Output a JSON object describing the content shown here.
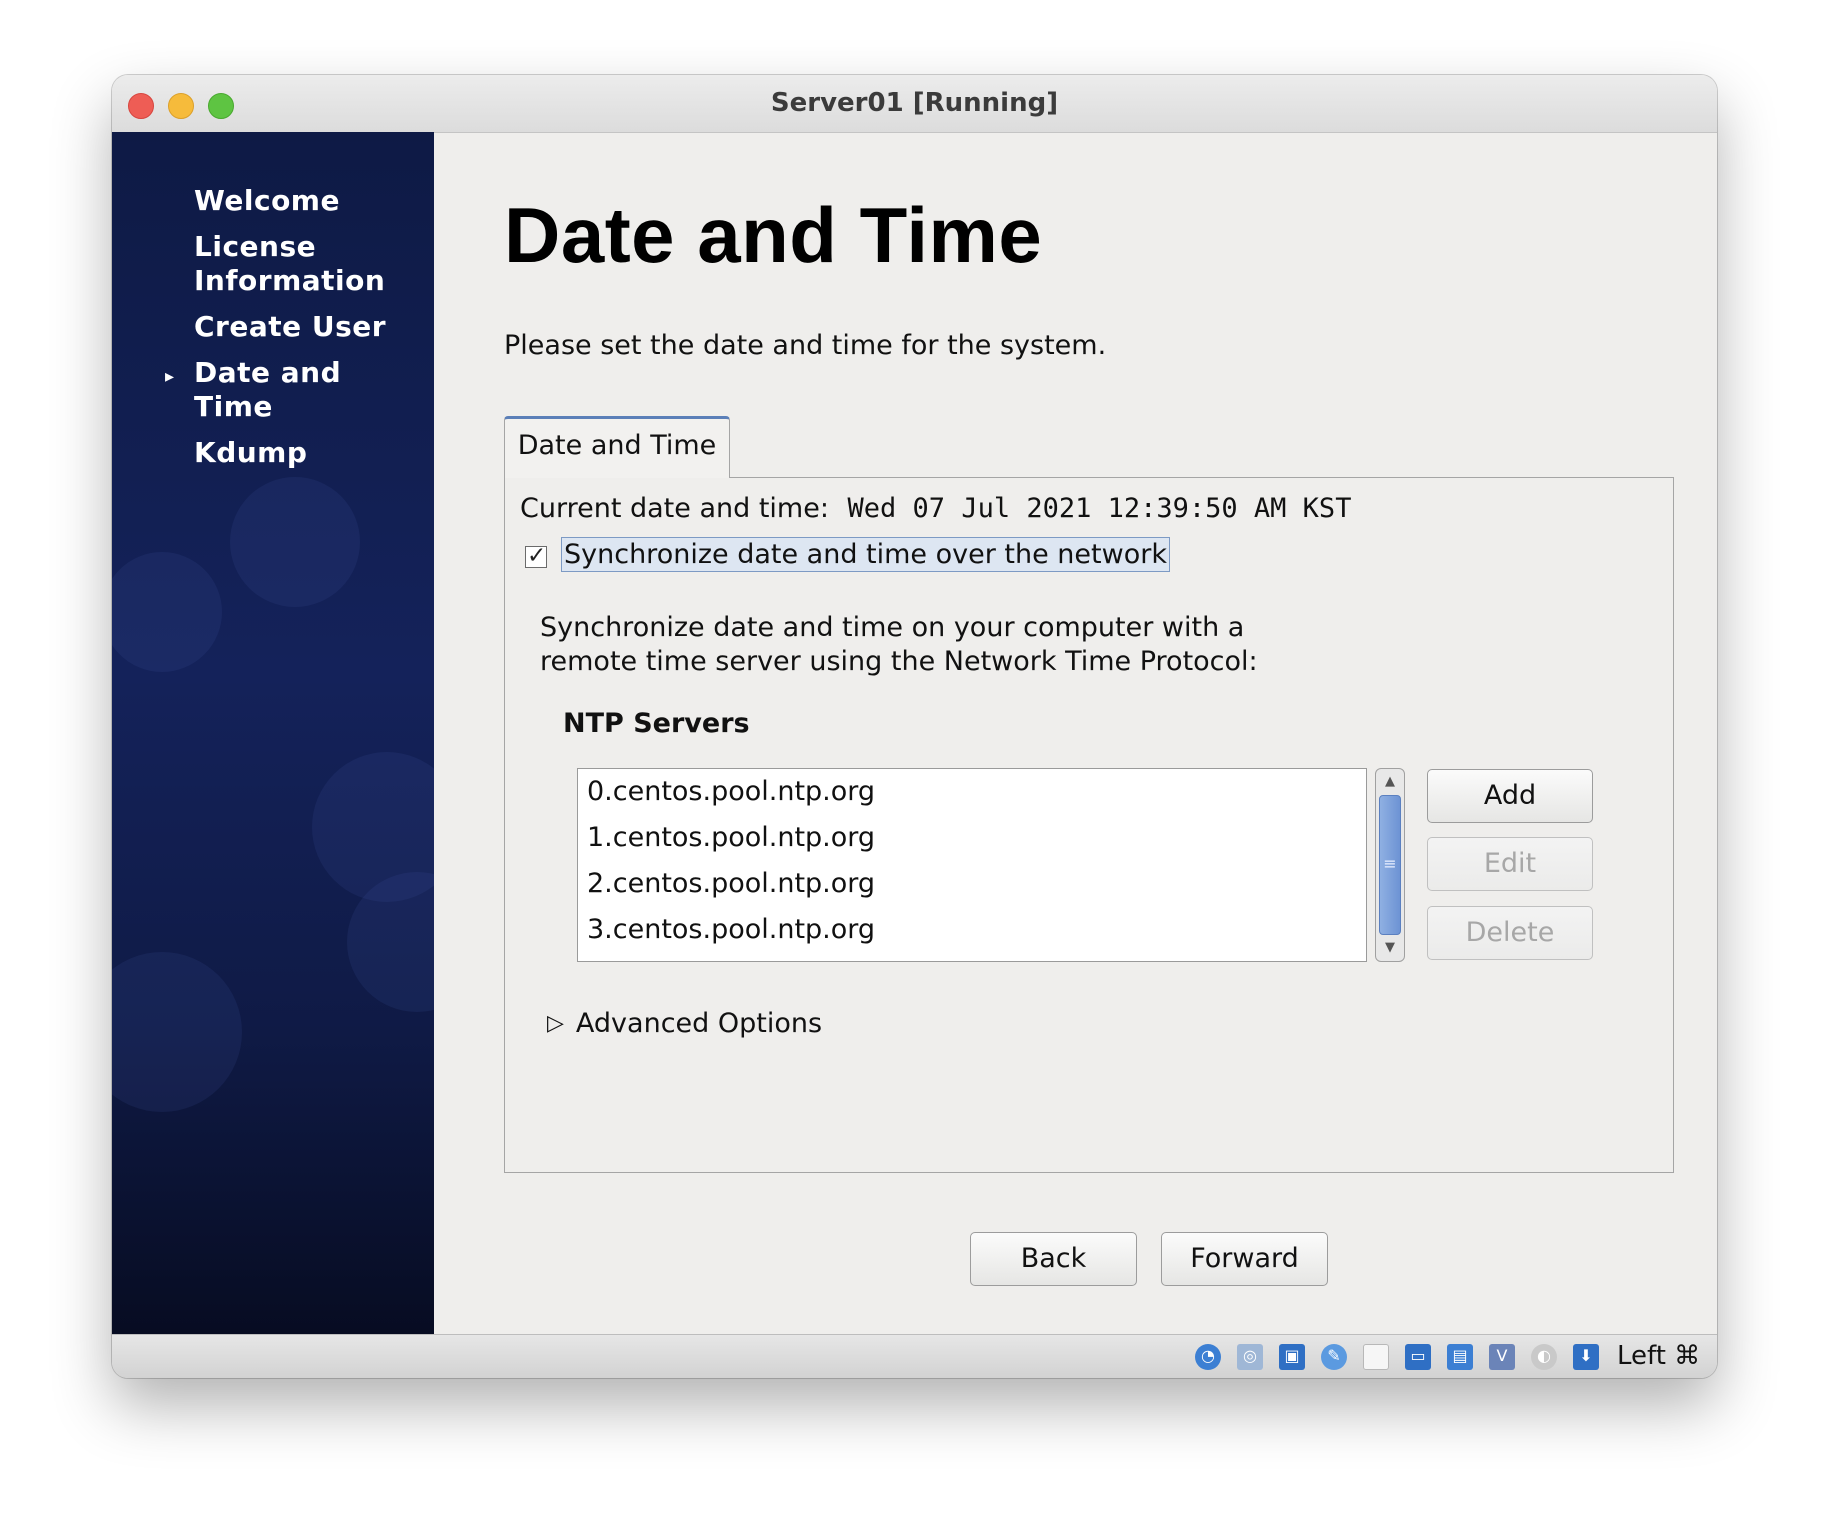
{
  "window": {
    "title": "Server01 [Running]"
  },
  "sidebar": {
    "items": [
      {
        "label": "Welcome",
        "active": false
      },
      {
        "label": "License Information",
        "active": false
      },
      {
        "label": "Create User",
        "active": false
      },
      {
        "label": "Date and Time",
        "active": true
      },
      {
        "label": "Kdump",
        "active": false
      }
    ]
  },
  "page": {
    "title": "Date and Time",
    "intro": "Please set the date and time for the system."
  },
  "tab": {
    "label": "Date and Time"
  },
  "datetime": {
    "current_label": "Current date and time:",
    "current_value": "Wed 07 Jul 2021 12:39:50 AM KST",
    "sync_label": "Synchronize date and time over the network",
    "sync_checked": true,
    "description": "Synchronize date and time on your computer with a remote time server using the Network Time Protocol:"
  },
  "ntp": {
    "heading": "NTP Servers",
    "servers": [
      "0.centos.pool.ntp.org",
      "1.centos.pool.ntp.org",
      "2.centos.pool.ntp.org",
      "3.centos.pool.ntp.org"
    ],
    "add_label": "Add",
    "edit_label": "Edit",
    "delete_label": "Delete"
  },
  "advanced": {
    "label": "Advanced Options"
  },
  "nav": {
    "back_label": "Back",
    "forward_label": "Forward"
  },
  "statusbar": {
    "icons": [
      "hard-disk-icon",
      "optical-drive-icon",
      "network-icon",
      "usb-icon",
      "shared-folders-icon",
      "display-icon",
      "video-capture-icon",
      "virtualization-icon",
      "mouse-integration-icon",
      "keyboard-capture-icon"
    ],
    "host_key": "Left ⌘"
  },
  "colors": {
    "sidebar_bg": "#13215a",
    "accent": "#5b7fb8",
    "window_bg": "#efeeec"
  }
}
